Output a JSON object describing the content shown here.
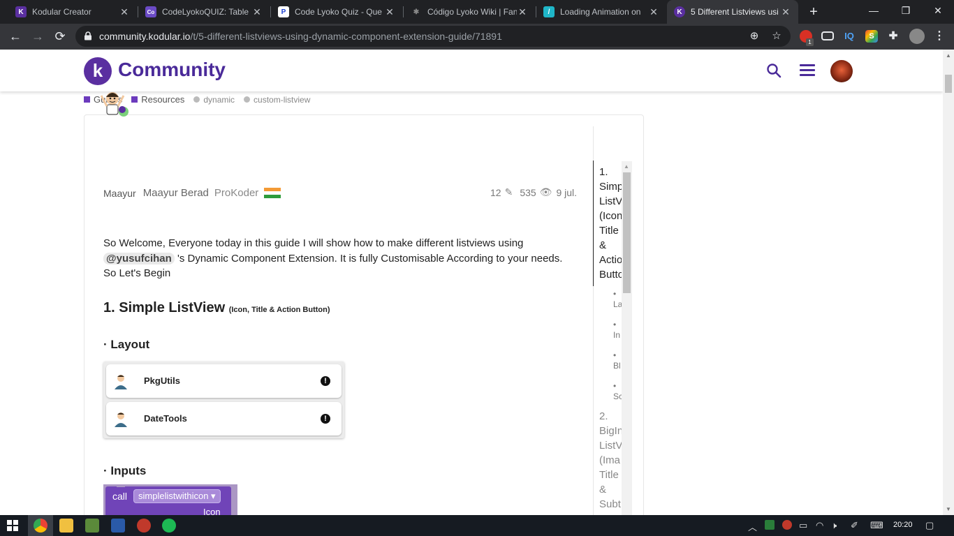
{
  "browser": {
    "tabs": [
      {
        "title": "Kodular Creator",
        "favicon": "K",
        "favicon_color": "#5a2fa0"
      },
      {
        "title": "CodeLyokoQUIZ: Table",
        "favicon": "Co",
        "favicon_color": "#6b4bc6"
      },
      {
        "title": "Code Lyoko Quiz - Que",
        "favicon": "P",
        "favicon_color": "#1c3fd1"
      },
      {
        "title": "Código Lyoko Wiki | Fan",
        "favicon": "✱",
        "favicon_color": "#202124"
      },
      {
        "title": "Loading Animation on ",
        "favicon": "/",
        "favicon_color": "#1fb6c8"
      },
      {
        "title": "5 Different Listviews usi",
        "favicon": "K",
        "favicon_color": "#5a2fa0"
      }
    ],
    "url_host": "community.kodular.io",
    "url_path": "/t/5-different-listviews-using-dynamic-component-extension-guide/71891",
    "ext_badge": "1",
    "ext_iq": "IQ",
    "ext_s": "S"
  },
  "site": {
    "logo_letter": "k",
    "logo_text": "Community",
    "accent": "#4a2a99"
  },
  "tags": {
    "guides": "Guides",
    "resources": "Resources",
    "dynamic": "dynamic",
    "custom": "custom-listview"
  },
  "post": {
    "username": "Maayur",
    "fullname": "Maayur Berad",
    "title": "ProKoder",
    "edits": "12",
    "views": "535",
    "date": "9 jul.",
    "intro_a": "So Welcome, Everyone today in this guide I will show how to make different listviews using",
    "mention": "@yusufcihan",
    "intro_b": " 's Dynamic Component Extension. It is fully Customisable According to your needs.",
    "intro_c": "So Let's Begin",
    "heading1": "1. Simple ListView",
    "heading1_small": "(Icon, Title & Action Button)",
    "layout_heading": "Layout",
    "inputs_heading": "Inputs",
    "items": [
      "PkgUtils",
      "DateTools"
    ],
    "block_call": "call",
    "block_dropdown": "simplelistwithicon",
    "block_icon": "Icon"
  },
  "toc": {
    "item1": "1.\nSimp\nListV\n(Icon\nTitle\n&\nActio\nButto",
    "subs": [
      "La",
      "In",
      "Bl",
      "Sc"
    ],
    "item2": "2.\nBigIn\nListV\n(Ima\nTitle\n&\nSubt"
  },
  "taskbar": {
    "time": "20:20"
  }
}
